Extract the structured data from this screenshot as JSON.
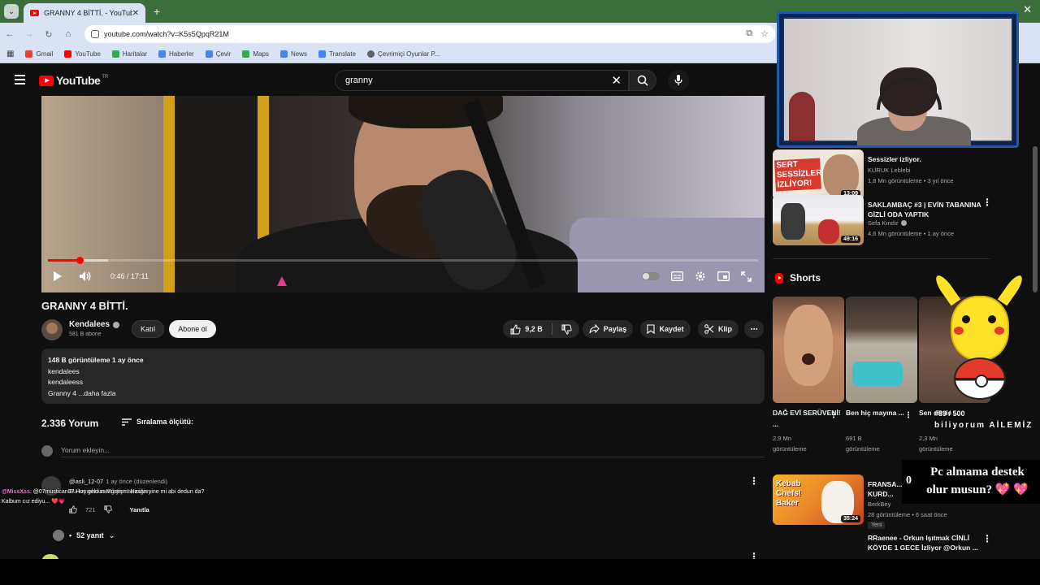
{
  "browser": {
    "tab_title": "GRANNY 4 BİTTİ. - YouTube",
    "tab_close": "✕",
    "new_tab": "+",
    "window_close": "✕",
    "url": "youtube.com/watch?v=K5s5QpqR21M",
    "bookmarks": [
      "Gmail",
      "YouTube",
      "Haritalar",
      "Haberler",
      "Çevir",
      "Maps",
      "News",
      "Translate",
      "Çevrimiçi Oyunlar P..."
    ]
  },
  "youtube": {
    "logo_text": "YouTube",
    "logo_region": "TR",
    "search_value": "granny",
    "search_clear": "✕"
  },
  "player": {
    "time": "0:46 / 17:11",
    "progress_fraction": 0.045,
    "buffer_fraction": 0.085
  },
  "video": {
    "title": "GRANNY 4 BİTTİ.",
    "channel_name": "Kendalees",
    "subscribers": "581 B abone",
    "join_label": "Katıl",
    "subscribe_label": "Abone ol",
    "likes": "9,2 B",
    "share_label": "Paylaş",
    "save_label": "Kaydet",
    "clip_label": "Klip",
    "more": "⋯"
  },
  "description": {
    "stats": "148 B görüntüleme  1 ay önce",
    "lines": [
      "kendalees",
      "kendaleess"
    ],
    "last_line": "Granny 4 ...daha fazla"
  },
  "comments": {
    "count": "2.336 Yorum",
    "sort_label": "Sıralama ölçütü:",
    "add_placeholder": "Yorum ekleyin...",
    "first": {
      "author": "@asli_12-07",
      "time": "1 ay önce (düzenlendi)",
      "text": "Bu kanalın sadığıyım abiciğim",
      "likes": "721",
      "reply_label": "Yanıtla",
      "replies": "52 yanıt"
    }
  },
  "chat_overlay": {
    "line1_nick": "@MissXss",
    "line1_text": ": @07mustican07 Hoş geldun Mustişm! Hasan yine mi abi dedun da?",
    "line2_text": "Kalbum cız ediyu... ❤️💗"
  },
  "sidebar": {
    "recs": [
      {
        "title": "Sessizler izliyor.",
        "channel": "KURUK Leblebi",
        "meta": "1,8 Mn görüntüleme • 3 yıl önce",
        "duration": "13:09",
        "thumb_text": "SERT SESSİZLER İZLİYOR!"
      },
      {
        "title": "SAKLAMBAÇ #3 | EVİN TABANINA GİZLİ ODA YAPTIK",
        "channel": "Sefa Kındır",
        "meta": "4,6 Mn görüntüleme • 1 ay önce",
        "duration": "49:16"
      }
    ],
    "shorts_title": "Shorts",
    "shorts": [
      {
        "title": "DAĞ EVİ SERÜVENİ! ...",
        "views": "2,9 Mn",
        "views_unit": "görüntüleme"
      },
      {
        "title": "Ben hiç mayına ...",
        "views": "691 B",
        "views_unit": "görüntüleme"
      },
      {
        "title": "Sen dil de ...",
        "views": "2,3 Mn",
        "views_unit": "görüntüleme"
      }
    ],
    "recs2": [
      {
        "title": "FRANSA...",
        "title_line2": "KURD...",
        "channel": "BerkBey",
        "meta": "28 görüntüleme • 6 saat önce",
        "badge": "Yeni",
        "duration": "35:24",
        "thumb_text": "Kebab Chefs! Baker"
      },
      {
        "title": "RRaenee - Orkun Işıtmak CİNLİ KÖYDE 1 GECE İzliyor @Orkun ...",
        "channel": "",
        "meta": ""
      }
    ]
  },
  "overlay": {
    "goal": "#89 / 500",
    "goal_label": "biliyorum AİLEMİZ",
    "donate_count": "0",
    "donate_line1": "Pc almama destek",
    "donate_line2": "olur musun?",
    "hearts": "💖 💖"
  },
  "colors": {
    "yt_red": "#ff0000",
    "bg": "#0f0f0f",
    "browser_green": "#3c6e3c",
    "browser_toolbar": "#d9e3f5",
    "webcam_frame": "#1d5aa8"
  }
}
